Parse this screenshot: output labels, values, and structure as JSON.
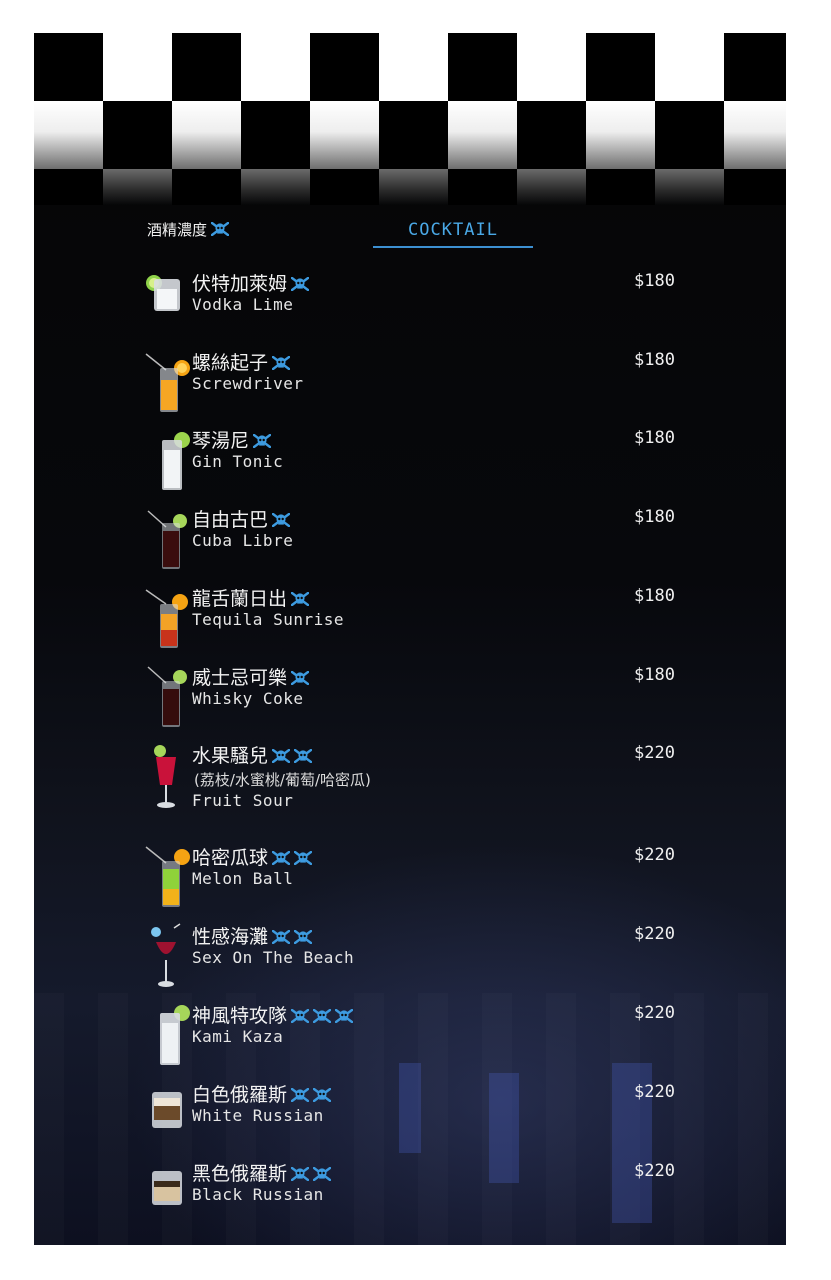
{
  "header": {
    "abv_label": "酒精濃度",
    "section_title": "COCKTAIL"
  },
  "colors": {
    "accent": "#4aa8e6",
    "background": "#07080c",
    "text": "#f2f2f2"
  },
  "items": [
    {
      "zh": "伏特加萊姆",
      "en": "Vodka Lime",
      "price": "$180",
      "strength": 1
    },
    {
      "zh": "螺絲起子",
      "en": "Screwdriver",
      "price": "$180",
      "strength": 1
    },
    {
      "zh": "琴湯尼",
      "en": "Gin Tonic",
      "price": "$180",
      "strength": 1
    },
    {
      "zh": "自由古巴",
      "en": "Cuba Libre",
      "price": "$180",
      "strength": 1
    },
    {
      "zh": "龍舌蘭日出",
      "en": "Tequila Sunrise",
      "price": "$180",
      "strength": 1
    },
    {
      "zh": "威士忌可樂",
      "en": "Whisky Coke",
      "price": "$180",
      "strength": 1
    },
    {
      "zh": "水果騷兒",
      "note": "(荔枝/水蜜桃/葡萄/哈密瓜)",
      "en": "Fruit Sour",
      "price": "$220",
      "strength": 2
    },
    {
      "zh": "哈密瓜球",
      "en": "Melon Ball",
      "price": "$220",
      "strength": 2
    },
    {
      "zh": "性感海灘",
      "en": "Sex On The Beach",
      "price": "$220",
      "strength": 2
    },
    {
      "zh": "神風特攻隊",
      "en": "Kami Kaza",
      "price": "$220",
      "strength": 3
    },
    {
      "zh": "白色俄羅斯",
      "en": "White Russian",
      "price": "$220",
      "strength": 2
    },
    {
      "zh": "黑色俄羅斯",
      "en": "Black Russian",
      "price": "$220",
      "strength": 2
    }
  ]
}
